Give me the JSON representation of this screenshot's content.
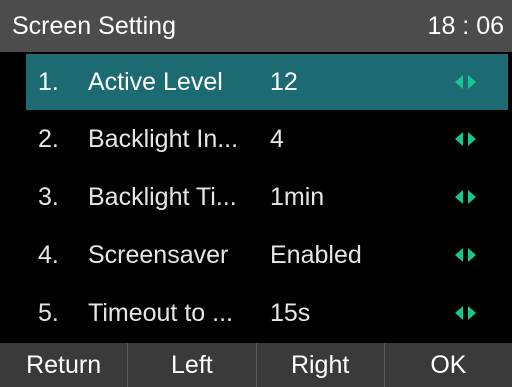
{
  "header": {
    "title": "Screen Setting",
    "time": "18 : 06"
  },
  "menu": {
    "items": [
      {
        "number": "1.",
        "label": "Active Level",
        "value": "12",
        "selected": true
      },
      {
        "number": "2.",
        "label": "Backlight In...",
        "value": "4",
        "selected": false
      },
      {
        "number": "3.",
        "label": "Backlight Ti...",
        "value": "1min",
        "selected": false
      },
      {
        "number": "4.",
        "label": "Screensaver",
        "value": "Enabled",
        "selected": false
      },
      {
        "number": "5.",
        "label": "Timeout to ...",
        "value": "15s",
        "selected": false
      }
    ],
    "arrow_icons": [
      "arrow-left-icon",
      "arrow-right-icon"
    ]
  },
  "softkeys": {
    "return_label": "Return",
    "left_label": "Left",
    "right_label": "Right",
    "ok_label": "OK"
  },
  "colors": {
    "title_bar_bg": "#4c4c4c",
    "selected_row_bg": "#1c6b73",
    "arrow_accent": "#16c78f",
    "softkey_bar_bg": "#3a3a3a",
    "background": "#000000"
  }
}
